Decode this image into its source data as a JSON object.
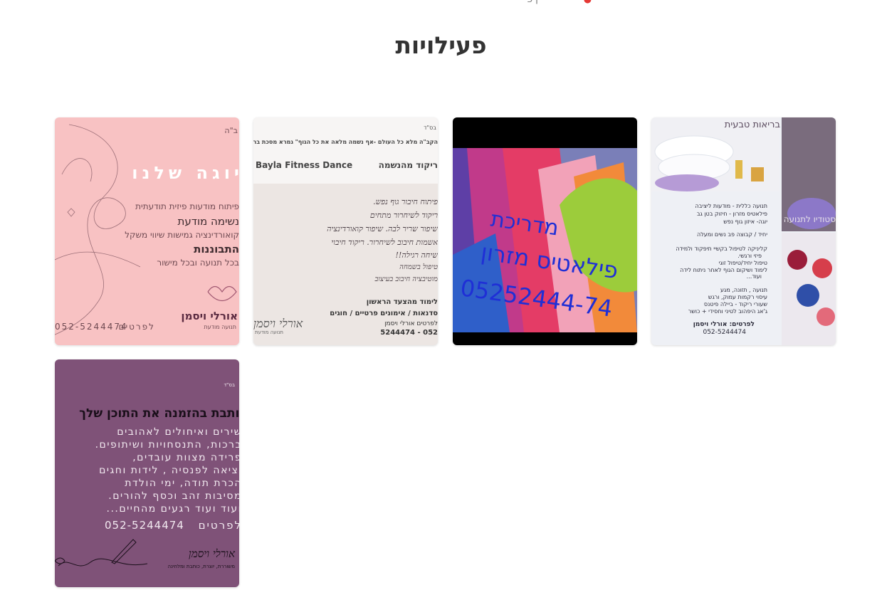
{
  "page": {
    "heading": "פעילויות"
  },
  "cards": [
    {
      "name": "yoga",
      "title": "יוגה שלנו",
      "bsd": "ב\"ה",
      "lines": [
        "פיתוח מודעות פיזית תודעתית",
        "נשימה מודעת",
        "קואורדינציה גמישות שיווי משקל",
        "התבוננות",
        "בכל תנועה ובכל מישור"
      ],
      "contact_label": "לפרטים",
      "phone": "052-5244474",
      "logo_name": "אורלי ויסמן",
      "logo_sub": "תנועה מודעת"
    },
    {
      "name": "dance",
      "bsd": "בס\"ד",
      "quote": "הקב\"ה מלא כל העולם -אף נשמה מלאה את כל הגוף\" גמרא מסכת ברכות",
      "label_en": "Bayla Fitness Dance",
      "label_he": "ריקוד מהנשמה",
      "hand_lines": [
        "פיתוח חיבור גוף נפש.",
        "ריקוד לשיחרור מתחים",
        "חיבור פנימי.",
        "שיפור שריר לבה. שיפור קואורדינציה",
        "אשמות חיבוב לשיחרור. ריקוד חיבוי",
        "שיחה רגילה!!",
        "מפגש חיבוב בעיצוב",
        "טיפול בשמחה",
        "מוטיבציה חיבוב בעיצוב",
        "מספרים חיבוב בעיצוב"
      ],
      "lines": [
        "לימוד מהצעד הראשון",
        "סדנאות / אימונים פרטיים / חוגים",
        "לפרטים אורלי ויסמן",
        "052 - 5244474"
      ],
      "logo_name": "אורלי ויסמן",
      "logo_sub": "תנועה מודעת"
    },
    {
      "name": "pilates",
      "lines": [
        "מדריכת",
        "פילאטיס מזרון",
        "05252444-74"
      ]
    },
    {
      "name": "health",
      "title": "בריאות טבעית",
      "side": "סטודיו לתנועה",
      "bullets": [
        "תנועה כללית - מודעות ליציבה",
        "פילאטיס מזרון - חיזוק בטן גב",
        "יוגה- איזון גוף נפש",
        "יחיד / קבוצה פב נשים ומעלה",
        "קליניקה לטיפול בקשיי תיפקוד ולמידה",
        "פיזי ורגשי.",
        "טיפול יחיד/טיפול זוגי",
        "לימוד ושיקום הגוף לאחר ניתוח לידה",
        "ועוד...",
        "תנועה , תזונה, מגע",
        "עיסוי רקמות עמוק, ורגש",
        "שעורי ריקוד - ביילה פיטנס",
        "ג'אג היפהוב לטיני וחסידי + כושר"
      ],
      "contact": "לפרטים: אורלי ויסמן",
      "phone": "052-5244474"
    },
    {
      "name": "writer",
      "bsd": "בס\"ד",
      "title": "כותבת בהזמנה את התוכן שלך",
      "lines": [
        "שירים ואיחולים לאהובים",
        "ברכות, התנסחויות ושיתופים.",
        "פרידה מצוות עובדים,",
        "יציאה לפנסיה , לידות וחגים",
        "הכרת תודה, ימי הולדת",
        "מסיבות זהב וכסף להורים.",
        "ועוד ועוד רגעים מהחיים..."
      ],
      "contact_label": "לפרטים",
      "phone": "052-5244474",
      "logo_name": "אורלי ויסמן",
      "logo_sub": "משוררת, יוצרת, כותבת ומלחינה"
    }
  ]
}
